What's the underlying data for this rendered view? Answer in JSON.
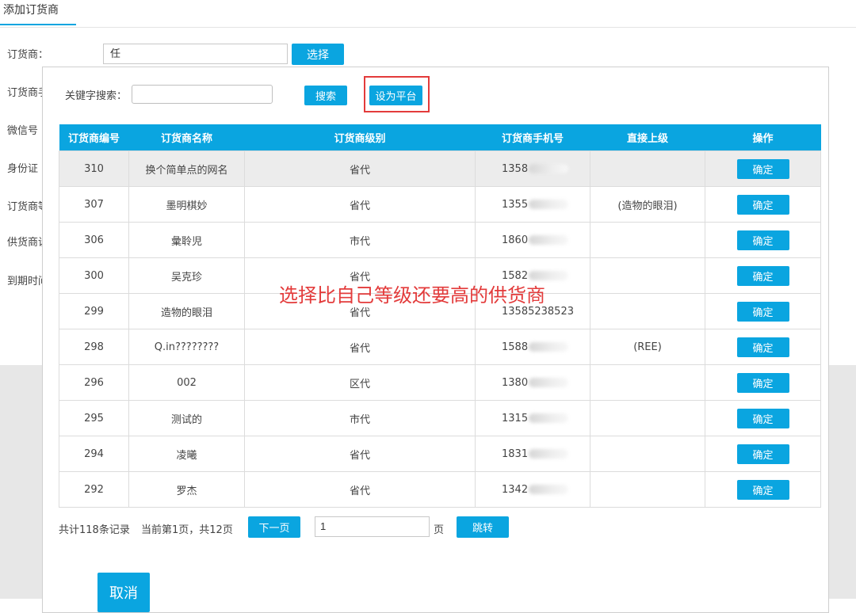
{
  "tabs": {
    "active": "添加订货商"
  },
  "form": {
    "labels": [
      "订货商：",
      "订货商手机号",
      "微信号",
      "身份证",
      "订货商等级",
      "供货商设置",
      "到期时间"
    ],
    "distributor_value": "任",
    "select_label": "选择"
  },
  "modal": {
    "keyword_label": "关键字搜索：",
    "search_label": "搜索",
    "set_platform_label": "设为平台",
    "annotation": "选择比自己等级还要高的供货商",
    "columns": [
      "订货商编号",
      "订货商名称",
      "订货商级别",
      "订货商手机号",
      "直接上级",
      "操作"
    ],
    "rows": [
      {
        "id": "310",
        "name": "换个简单点的网名",
        "level": "省代",
        "phone": "1358",
        "parent": ""
      },
      {
        "id": "307",
        "name": "墨明棋妙",
        "level": "省代",
        "phone": "1355",
        "parent": "(造物的眼泪)"
      },
      {
        "id": "306",
        "name": "彙聆児",
        "level": "市代",
        "phone": "1860",
        "parent": ""
      },
      {
        "id": "300",
        "name": "吴克珍",
        "level": "省代",
        "phone": "1582",
        "parent": ""
      },
      {
        "id": "299",
        "name": "造物的眼泪",
        "level": "省代",
        "phone": "13585238523",
        "parent": ""
      },
      {
        "id": "298",
        "name": "Q.in????????",
        "level": "省代",
        "phone": "1588",
        "parent": "(REE)"
      },
      {
        "id": "296",
        "name": "002",
        "level": "区代",
        "phone": "1380",
        "parent": ""
      },
      {
        "id": "295",
        "name": "测试的",
        "level": "市代",
        "phone": "1315",
        "parent": ""
      },
      {
        "id": "294",
        "name": "凌曦",
        "level": "省代",
        "phone": "1831",
        "parent": ""
      },
      {
        "id": "292",
        "name": "罗杰",
        "level": "省代",
        "phone": "1342",
        "parent": ""
      }
    ],
    "confirm_label": "确定",
    "pager": {
      "total": "共计118条记录",
      "current": "当前第1页，共12页",
      "next_label": "下一页",
      "page_value": "1",
      "page_unit": "页",
      "jump_label": "跳转"
    },
    "cancel_label": "取消"
  },
  "colors": {
    "accent": "#0aa5e0",
    "annotation": "#e33b3b",
    "highlight_row": "#ececec"
  }
}
